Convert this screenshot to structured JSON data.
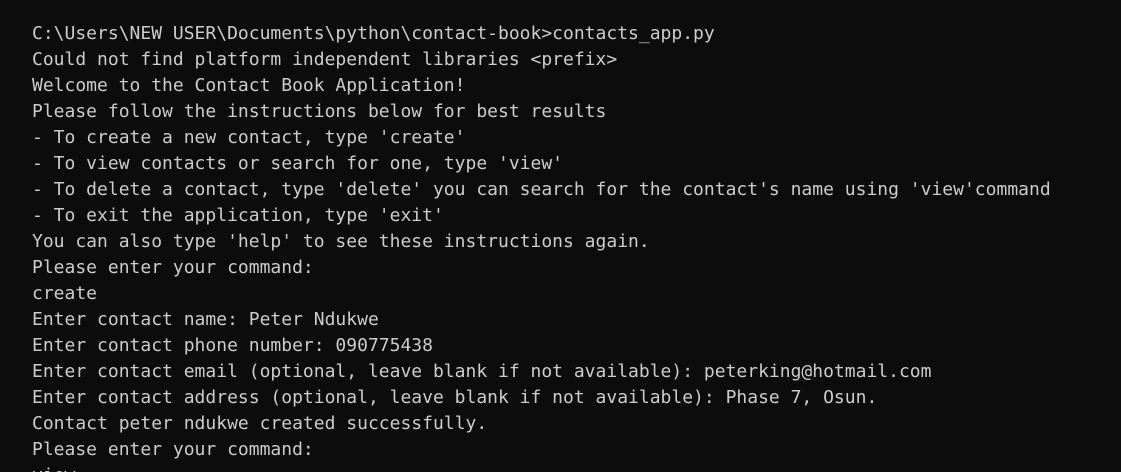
{
  "terminal": {
    "lines": [
      "C:\\Users\\NEW USER\\Documents\\python\\contact-book>contacts_app.py",
      "Could not find platform independent libraries <prefix>",
      "Welcome to the Contact Book Application!",
      "Please follow the instructions below for best results",
      "- To create a new contact, type 'create'",
      "- To view contacts or search for one, type 'view'",
      "- To delete a contact, type 'delete' you can search for the contact's name using 'view'command",
      "- To exit the application, type 'exit'",
      "You can also type 'help' to see these instructions again.",
      "Please enter your command:",
      "create",
      "Enter contact name: Peter Ndukwe",
      "Enter contact phone number: 090775438",
      "Enter contact email (optional, leave blank if not available): peterking@hotmail.com",
      "Enter contact address (optional, leave blank if not available): Phase 7, Osun.",
      "Contact peter ndukwe created successfully.",
      "Please enter your command:",
      "view"
    ]
  },
  "colors": {
    "background": "#0c0c0c",
    "text": "#cccccc"
  }
}
